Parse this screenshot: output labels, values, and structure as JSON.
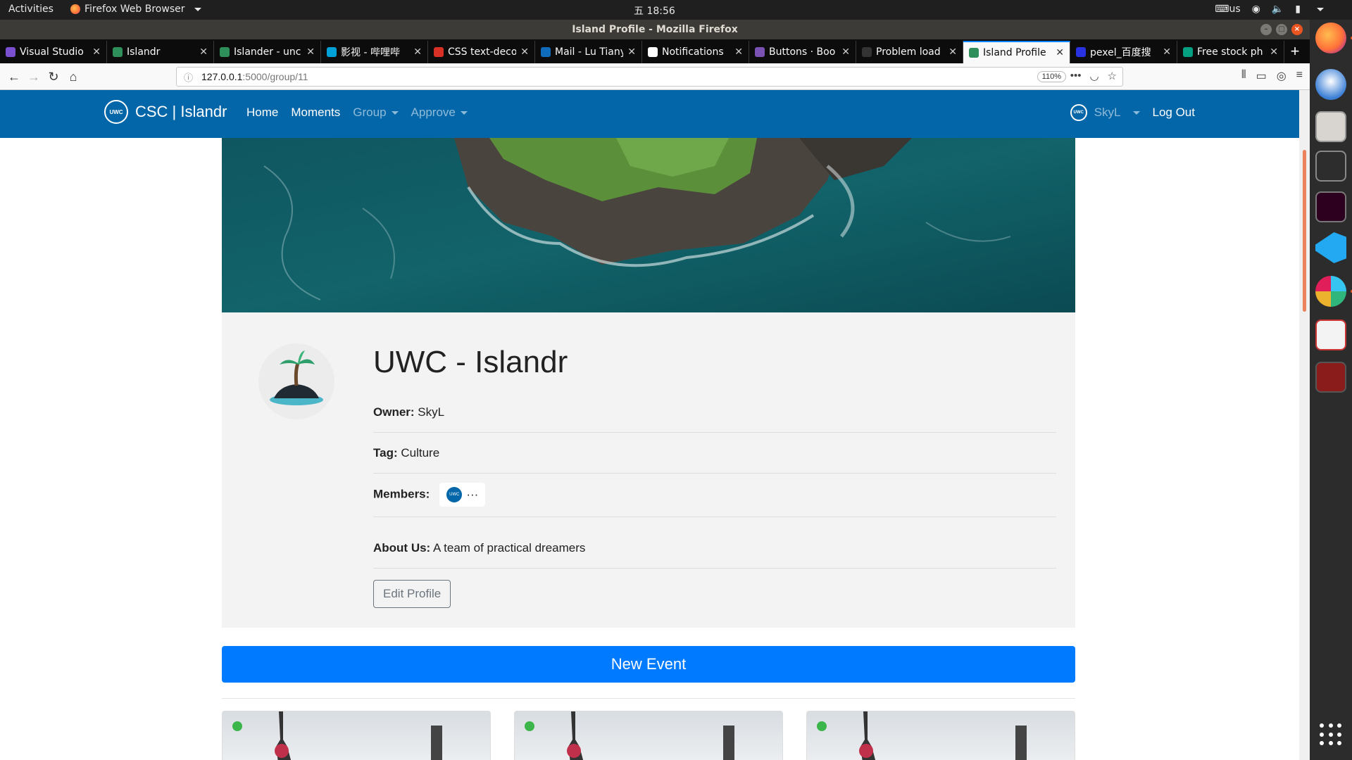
{
  "system": {
    "activities": "Activities",
    "app_menu": "Firefox Web Browser",
    "clock": "五 18:56",
    "keyboard": "us"
  },
  "window": {
    "title": "Island Profile - Mozilla Firefox"
  },
  "tabs": [
    {
      "label": "Visual Studio",
      "color": "#7a4fd0"
    },
    {
      "label": "Islandr",
      "color": "#2f8f5b"
    },
    {
      "label": "Islander - unc",
      "color": "#2f8f5b"
    },
    {
      "label": "影视 - 哔哩哔",
      "color": "#00a1d6"
    },
    {
      "label": "CSS text-deco",
      "color": "#d93025"
    },
    {
      "label": "Mail - Lu Tiany",
      "color": "#0f6cbd"
    },
    {
      "label": "Notifications",
      "color": "#ffffff"
    },
    {
      "label": "Buttons · Boo",
      "color": "#7952b3"
    },
    {
      "label": "Problem load",
      "color": "#333333"
    },
    {
      "label": "Island Profile",
      "color": "#2f8f5b",
      "active": true
    },
    {
      "label": "pexel_百度搜",
      "color": "#2932e1"
    },
    {
      "label": "Free stock ph",
      "color": "#05a081"
    }
  ],
  "urlbar": {
    "host": "127.0.0.1",
    "path": ":5000/group/11",
    "zoom": "110%"
  },
  "site": {
    "logo_text": "UWC",
    "brand": "CSC | Islandr",
    "nav": {
      "home": "Home",
      "moments": "Moments",
      "group": "Group",
      "approve": "Approve"
    },
    "user": "SkyL",
    "logout": "Log Out"
  },
  "profile": {
    "title": "UWC - Islandr",
    "owner_label": "Owner:",
    "owner": "SkyL",
    "tag_label": "Tag:",
    "tag": "Culture",
    "members_label": "Members:",
    "members_more": "···",
    "about_label": "About Us:",
    "about": "A team of practical dreamers",
    "edit_button": "Edit Profile"
  },
  "events": {
    "new_event_button": "New Event"
  },
  "colors": {
    "navbar": "#0366a8",
    "primary": "#007bff",
    "accent": "#e95420"
  }
}
